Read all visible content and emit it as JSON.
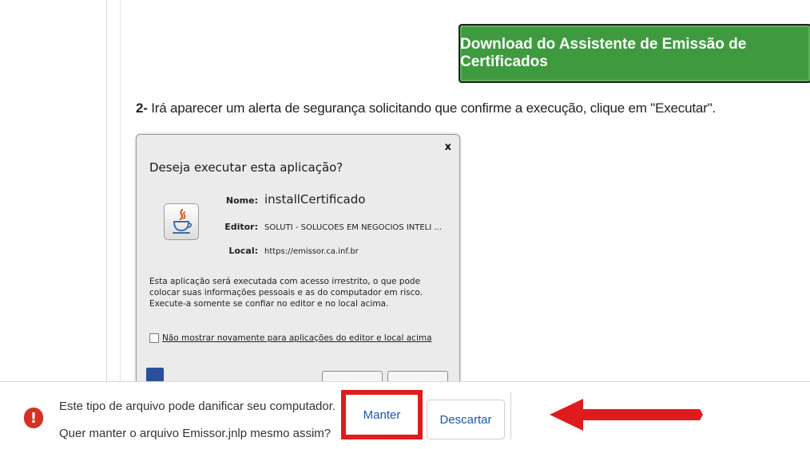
{
  "page": {
    "download_button": "Download do Assistente de Emissão de Certificados",
    "step_number": "2-",
    "step_text": " Irá aparecer um alerta de segurança solicitando que confirme a execução, clique em \"Executar\"."
  },
  "dialog": {
    "title": "Deseja executar esta aplicação?",
    "close": "x",
    "name_label": "Nome:",
    "name_value": "installCertificado",
    "editor_label": "Editor:",
    "editor_value": "SOLUTI - SOLUCOES EM NEGOCIOS INTELI ...",
    "local_label": "Local:",
    "local_value": "https://emissor.ca.inf.br",
    "description": "Esta aplicação será executada com acesso irrestrito, o que pode colocar suas informações pessoais e as do computador em risco. Execute-a somente se confiar no editor e no local acima.",
    "checkbox_label": "Não mostrar novamente para aplicações do editor e local acima"
  },
  "download_bar": {
    "warning_line1": "Este tipo de arquivo pode danificar seu computador.",
    "warning_line2": "Quer manter o arquivo Emissor.jnlp mesmo assim?",
    "keep_button": "Manter",
    "discard_button": "Descartar",
    "warning_icon": "!"
  },
  "colors": {
    "download_button_bg": "#3f9a3f",
    "highlight_red": "#e01b1b",
    "link_blue": "#1a56b4",
    "warning_red": "#d93025"
  },
  "icons": [
    "java-icon",
    "warning-icon",
    "red-arrow-icon",
    "close-icon"
  ]
}
